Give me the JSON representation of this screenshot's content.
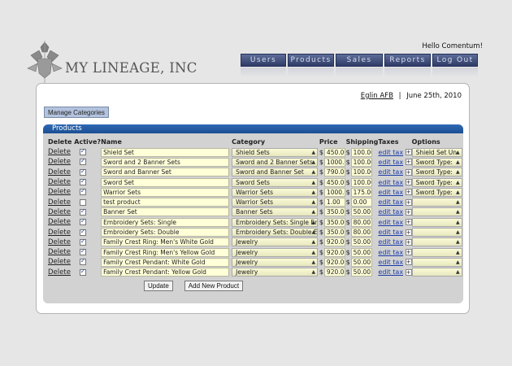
{
  "greeting": "Hello Comentum!",
  "brand": {
    "name": "MY LINEAGE, INC"
  },
  "nav": [
    "Users",
    "Products",
    "Sales",
    "Reports",
    "Log Out"
  ],
  "location": {
    "link": "Eglin AFB",
    "separator": "|",
    "date": "June 25th, 2010"
  },
  "manage_label": "Manage Categories",
  "panel_title": "Products",
  "columns": {
    "delete_active": "Delete Active?",
    "name": "Name",
    "category": "Category",
    "price": "Price",
    "shipping": "Shipping",
    "taxes": "Taxes",
    "options": "Options"
  },
  "delete_label": "Delete",
  "currency": "$",
  "edit_tax_label": "edit tax",
  "plus_label": "+",
  "rows": [
    {
      "active": true,
      "name": "Shield Set",
      "category": "Shield Sets",
      "price": "450.00",
      "shipping": "100.00",
      "option": "Shield Set Un"
    },
    {
      "active": true,
      "name": "Sword and 2 Banner Sets",
      "category": "Sword and 2 Banner Sets",
      "price": "1000.00",
      "shipping": "100.00",
      "option": "Sword Type:"
    },
    {
      "active": true,
      "name": "Sword and Banner Set",
      "category": "Sword and Banner Set",
      "price": "790.00",
      "shipping": "100.00",
      "option": "Sword Type:"
    },
    {
      "active": true,
      "name": "Sword Set",
      "category": "Sword Sets",
      "price": "450.00",
      "shipping": "100.00",
      "option": "Sword Type:"
    },
    {
      "active": true,
      "name": "Warrior Sets",
      "category": "Warrior Sets",
      "price": "1000.00",
      "shipping": "175.00",
      "option": "Sword Type:"
    },
    {
      "active": false,
      "name": "test product",
      "category": "Warrior Sets",
      "price": "1.00",
      "shipping": "0.00",
      "option": ""
    },
    {
      "active": true,
      "name": "Banner Set",
      "category": "Banner Sets",
      "price": "350.00",
      "shipping": "50.00",
      "option": ""
    },
    {
      "active": true,
      "name": "Embroidery Sets: Single",
      "category": "Embroidery Sets: Single Em",
      "price": "350.00",
      "shipping": "80.00",
      "option": ""
    },
    {
      "active": true,
      "name": "Embroidery Sets: Double",
      "category": "Embroidery Sets: Double Em",
      "price": "350.00",
      "shipping": "80.00",
      "option": ""
    },
    {
      "active": true,
      "name": "Family Crest Ring: Men's White Gold",
      "category": "Jewelry",
      "price": "920.00",
      "shipping": "50.00",
      "option": ""
    },
    {
      "active": true,
      "name": "Family Crest Ring: Men's Yellow Gold",
      "category": "Jewelry",
      "price": "920.00",
      "shipping": "50.00",
      "option": ""
    },
    {
      "active": true,
      "name": "Family Crest Pendant: White Gold",
      "category": "Jewelry",
      "price": "920.00",
      "shipping": "50.00",
      "option": ""
    },
    {
      "active": true,
      "name": "Family Crest Pendant: Yellow Gold",
      "category": "Jewelry",
      "price": "920.00",
      "shipping": "50.00",
      "option": ""
    }
  ],
  "buttons": {
    "update": "Update",
    "add_new": "Add New Product"
  },
  "colors": {
    "nav": "#3a4775",
    "panel_header": "#245aa3",
    "input_bg": "#ffffd8",
    "link": "#1a3ca8"
  },
  "icons": {
    "logo": "crest-icon",
    "checkbox": "check-icon",
    "select": "updown-arrow-icon"
  }
}
